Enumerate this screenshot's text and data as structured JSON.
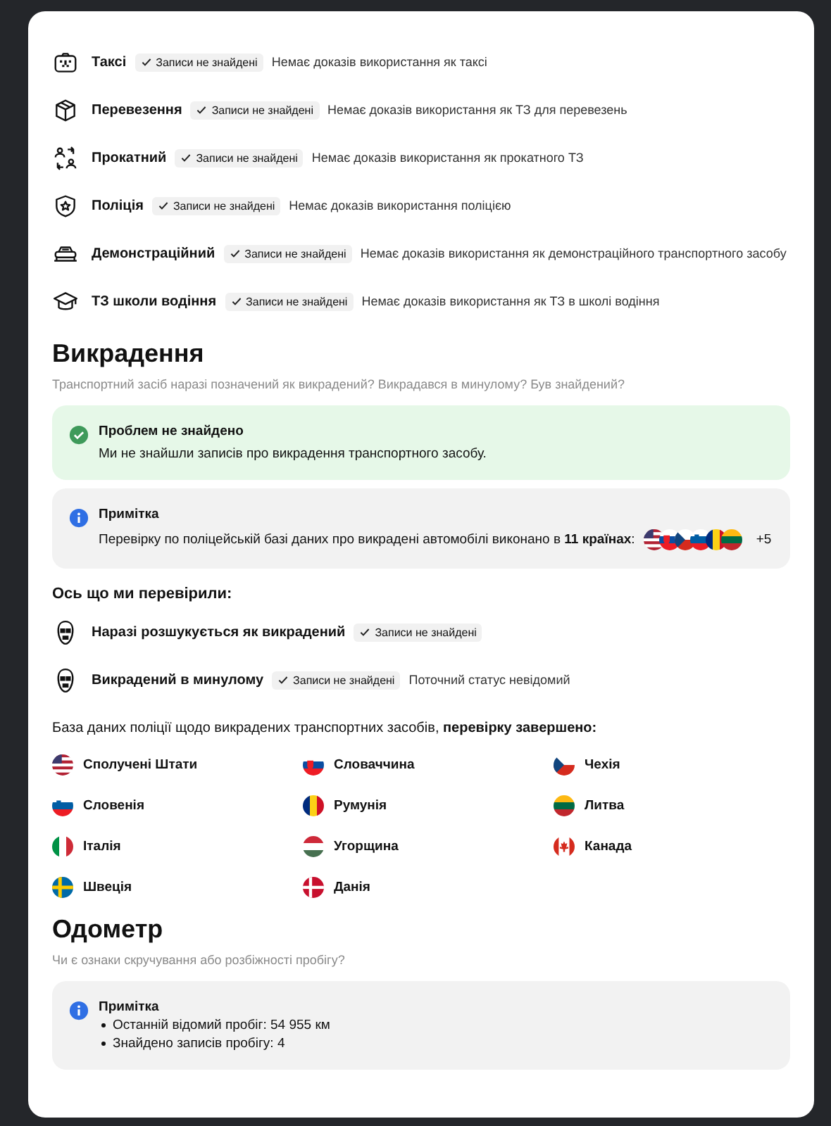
{
  "usage_checks": [
    {
      "kind": "taxi",
      "label": "Таксі",
      "badge": "Записи не знайдені",
      "description": "Немає доказів використання як таксі"
    },
    {
      "kind": "box",
      "label": "Перевезення",
      "badge": "Записи не знайдені",
      "description": "Немає доказів використання як ТЗ для перевезень"
    },
    {
      "kind": "swap",
      "label": "Прокатний",
      "badge": "Записи не знайдені",
      "description": "Немає доказів використання як прокатного ТЗ"
    },
    {
      "kind": "shield",
      "label": "Поліція",
      "badge": "Записи не знайдені",
      "description": "Немає доказів використання поліцією"
    },
    {
      "kind": "car",
      "label": "Демонстраційний",
      "badge": "Записи не знайдені",
      "description": "Немає доказів використання як демонстраційного транспортного засобу"
    },
    {
      "kind": "cap",
      "label": "ТЗ школи водіння",
      "badge": "Записи не знайдені",
      "description": "Немає доказів використання як ТЗ в школі водіння"
    }
  ],
  "theft": {
    "title": "Викрадення",
    "subtitle": "Транспортний засіб наразі позначений як викрадений? Викрадався в минулому? Був знайдений?",
    "notices": [
      {
        "kind": "success",
        "title": "Проблем не знайдено",
        "text": "Ми не знайшли записів про викрадення транспортного засобу."
      },
      {
        "kind": "info",
        "title": "Примітка",
        "text": "Перевірку по поліцейській базі даних про викрадені автомобілі виконано в **11 країнах**:",
        "flags": [
          {
            "kind": "us"
          },
          {
            "kind": "sk"
          },
          {
            "kind": "cz"
          },
          {
            "kind": "si"
          },
          {
            "kind": "ro"
          },
          {
            "kind": "lt"
          }
        ],
        "more": "+5"
      }
    ],
    "checked_title": "Ось що ми перевірили:",
    "checks": [
      {
        "label": "Наразі розшукується як викрадений",
        "badge": "Записи не знайдені"
      },
      {
        "label": "Викрадений в минулому",
        "badge": "Записи не знайдені",
        "description": "Поточний статус невідомий"
      }
    ],
    "database_text": "База даних поліції щодо викрадених транспортних засобів, **перевірку завершено:**",
    "countries": [
      {
        "kind": "us",
        "name": "Сполучені Штати"
      },
      {
        "kind": "sk",
        "name": "Словаччина"
      },
      {
        "kind": "cz",
        "name": "Чехія"
      },
      {
        "kind": "si",
        "name": "Словенія"
      },
      {
        "kind": "ro",
        "name": "Румунія"
      },
      {
        "kind": "lt",
        "name": "Литва"
      },
      {
        "kind": "it",
        "name": "Італія"
      },
      {
        "kind": "hu",
        "name": "Угорщина"
      },
      {
        "kind": "ca",
        "name": "Канада"
      },
      {
        "kind": "se",
        "name": "Швеція"
      },
      {
        "kind": "dk",
        "name": "Данія"
      }
    ]
  },
  "odometer": {
    "title": "Одометр",
    "subtitle": "Чи є ознаки скручування або розбіжності пробігу?",
    "note": {
      "kind": "info",
      "title": "Примітка",
      "items": [
        "Останній відомий пробіг: 54 955 км",
        "Знайдено записів пробігу: 4"
      ]
    }
  }
}
